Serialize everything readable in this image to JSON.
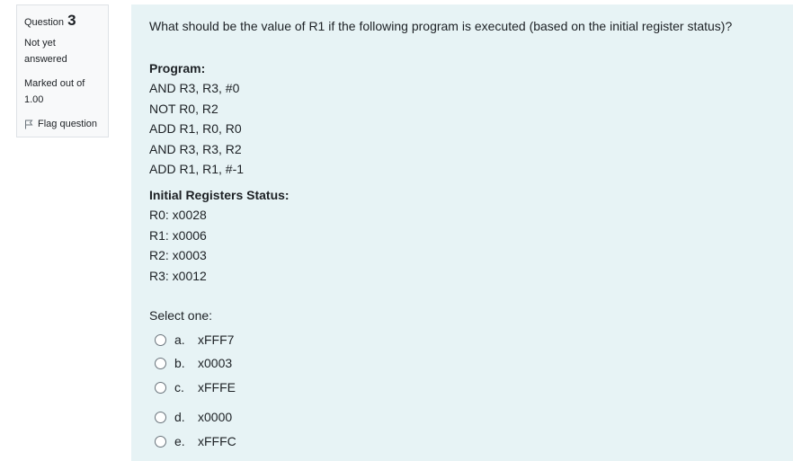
{
  "info": {
    "question_label": "Question",
    "question_number": "3",
    "state": "Not yet answered",
    "grade": "Marked out of 1.00",
    "flag_label": "Flag question"
  },
  "question": {
    "text": "What should be the value of R1 if the following program is executed (based on the initial register status)?",
    "program_heading": "Program:",
    "program": [
      "AND R3, R3, #0",
      "NOT R0, R2",
      "ADD R1, R0, R0",
      "AND R3, R3, R2",
      "ADD R1, R1, #-1"
    ],
    "registers_heading": "Initial Registers Status:",
    "registers": [
      "R0: x0028",
      "R1: x0006",
      "R2: x0003",
      "R3: x0012"
    ],
    "prompt": "Select one:",
    "options": [
      {
        "letter": "a.",
        "value": "xFFF7"
      },
      {
        "letter": "b.",
        "value": "x0003"
      },
      {
        "letter": "c.",
        "value": "xFFFE"
      },
      {
        "letter": "d.",
        "value": "x0000"
      },
      {
        "letter": "e.",
        "value": "xFFFC"
      }
    ]
  },
  "icons": {
    "flag": "flag-icon",
    "radio": "radio-button"
  }
}
